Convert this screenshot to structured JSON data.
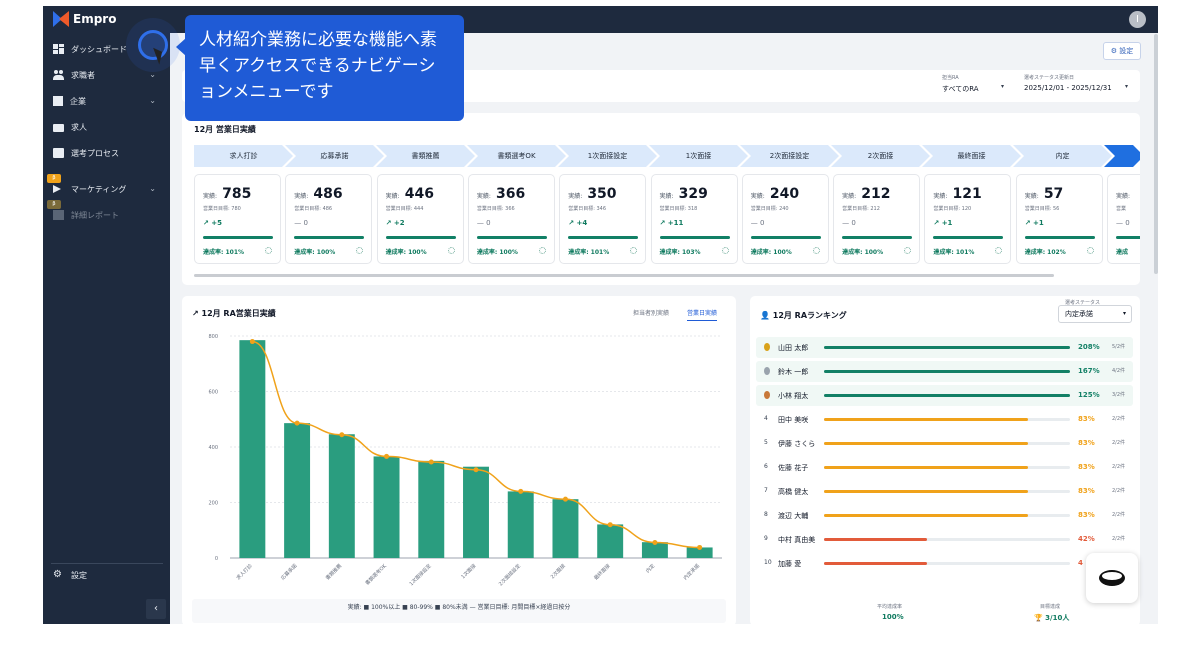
{
  "app": {
    "brand": "Empro",
    "avatar_initial": "I"
  },
  "sidebar": {
    "items": [
      {
        "label": "ダッシュボード",
        "icon": "dashboard-icon"
      },
      {
        "label": "求職者",
        "icon": "people-icon",
        "has_chevron": true
      },
      {
        "label": "企業",
        "icon": "building-icon",
        "has_chevron": true
      },
      {
        "label": "求人",
        "icon": "briefcase-icon"
      },
      {
        "label": "選考プロセス",
        "icon": "clipboard-icon"
      },
      {
        "label": "マーケティング",
        "icon": "megaphone-icon",
        "has_chevron": true,
        "badge": "β"
      },
      {
        "label": "詳細レポート",
        "icon": "report-icon",
        "badge": "β",
        "disabled": true
      }
    ],
    "settings_label": "設定",
    "collapse_glyph": "‹"
  },
  "tooltip": {
    "lines": [
      "人材紹介業務に必要な機能へ素",
      "早くアクセスできるナビゲーシ",
      "ョンメニューです"
    ]
  },
  "header": {
    "settings_button": "⚙ 設定"
  },
  "filters": [
    {
      "label": "担当RA",
      "value": "すべてのRA"
    },
    {
      "label": "選考ステータス更新日",
      "value": "2025/12/01 - 2025/12/31"
    }
  ],
  "sales": {
    "title": "12月 営業日実績",
    "steps": [
      "求人打診",
      "応募承諾",
      "書類推薦",
      "書類選考OK",
      "1次面接設定",
      "1次面接",
      "2次面接設定",
      "2次面接",
      "最終面接",
      "内定",
      ""
    ],
    "kpis": [
      {
        "label": "実績:",
        "value": "785",
        "target": "営業日目標: 780",
        "diff": "↗ +5",
        "rate": "達成率: 101%"
      },
      {
        "label": "実績:",
        "value": "486",
        "target": "営業日目標: 486",
        "diff": "— 0",
        "rate": "達成率: 100%"
      },
      {
        "label": "実績:",
        "value": "446",
        "target": "営業日目標: 444",
        "diff": "↗ +2",
        "rate": "達成率: 100%"
      },
      {
        "label": "実績:",
        "value": "366",
        "target": "営業日目標: 366",
        "diff": "— 0",
        "rate": "達成率: 100%"
      },
      {
        "label": "実績:",
        "value": "350",
        "target": "営業日目標: 346",
        "diff": "↗ +4",
        "rate": "達成率: 101%"
      },
      {
        "label": "実績:",
        "value": "329",
        "target": "営業日目標: 318",
        "diff": "↗ +11",
        "rate": "達成率: 103%"
      },
      {
        "label": "実績:",
        "value": "240",
        "target": "営業日目標: 240",
        "diff": "— 0",
        "rate": "達成率: 100%"
      },
      {
        "label": "実績:",
        "value": "212",
        "target": "営業日目標: 212",
        "diff": "— 0",
        "rate": "達成率: 100%"
      },
      {
        "label": "実績:",
        "value": "121",
        "target": "営業日目標: 120",
        "diff": "↗ +1",
        "rate": "達成率: 101%"
      },
      {
        "label": "実績:",
        "value": "57",
        "target": "営業日目標: 56",
        "diff": "↗ +1",
        "rate": "達成率: 102%"
      },
      {
        "label": "実績:",
        "value": "",
        "target": "営業",
        "diff": "— 0",
        "rate": "達成"
      }
    ]
  },
  "ra_chart": {
    "title": "12月 RA営業日実績",
    "tabs": [
      "担当者別実績",
      "営業日実績"
    ],
    "legend": "実績: ■ 100%以上 ■ 80-99% ■ 80%未満 — 営業日目標: 月間目標×経過日按分"
  },
  "chart_data": {
    "type": "bar",
    "categories": [
      "求人打診",
      "応募承諾",
      "書類推薦",
      "書類選考OK",
      "1次面接設定",
      "1次面接",
      "2次面接設定",
      "2次面接",
      "最終面接",
      "内定",
      "内定承諾"
    ],
    "series": [
      {
        "name": "実績",
        "type": "bar",
        "values": [
          785,
          486,
          446,
          366,
          350,
          329,
          240,
          212,
          121,
          57,
          38
        ]
      },
      {
        "name": "営業日目標",
        "type": "line",
        "values": [
          780,
          486,
          444,
          366,
          346,
          318,
          240,
          212,
          120,
          56,
          38
        ]
      }
    ],
    "ylim": [
      0,
      800
    ],
    "yticks": [
      0,
      200,
      400,
      600,
      800
    ],
    "colors": {
      "bar": "#2a9d7f",
      "line": "#f0a21a"
    }
  },
  "ranking": {
    "title": "12月 RAランキング",
    "select_label": "選考ステータス",
    "select_value": "内定承諾",
    "rows": [
      {
        "rank": "1",
        "name": "山田 太郎",
        "pct": "208%",
        "count": "5/2件",
        "fill": 1.0,
        "color": "#138066"
      },
      {
        "rank": "2",
        "name": "鈴木 一郎",
        "pct": "167%",
        "count": "4/2件",
        "fill": 1.0,
        "color": "#138066"
      },
      {
        "rank": "3",
        "name": "小林 翔太",
        "pct": "125%",
        "count": "3/2件",
        "fill": 1.0,
        "color": "#138066"
      },
      {
        "rank": "4",
        "name": "田中 美咲",
        "pct": "83%",
        "count": "2/2件",
        "fill": 0.83,
        "color": "#f0a21a"
      },
      {
        "rank": "5",
        "name": "伊藤 さくら",
        "pct": "83%",
        "count": "2/2件",
        "fill": 0.83,
        "color": "#f0a21a"
      },
      {
        "rank": "6",
        "name": "佐藤 花子",
        "pct": "83%",
        "count": "2/2件",
        "fill": 0.83,
        "color": "#f0a21a"
      },
      {
        "rank": "7",
        "name": "高橋 健太",
        "pct": "83%",
        "count": "2/2件",
        "fill": 0.83,
        "color": "#f0a21a"
      },
      {
        "rank": "8",
        "name": "渡辺 大輔",
        "pct": "83%",
        "count": "2/2件",
        "fill": 0.83,
        "color": "#f0a21a"
      },
      {
        "rank": "9",
        "name": "中村 真由美",
        "pct": "42%",
        "count": "2/2件",
        "fill": 0.42,
        "color": "#e25b3a"
      },
      {
        "rank": "10",
        "name": "加藤 愛",
        "pct": "4",
        "count": "",
        "fill": 0.42,
        "color": "#e25b3a"
      }
    ],
    "footer": [
      {
        "label": "平均達成率",
        "value": "100%"
      },
      {
        "label": "目標達成",
        "value": "🏆 3/10人"
      }
    ]
  }
}
